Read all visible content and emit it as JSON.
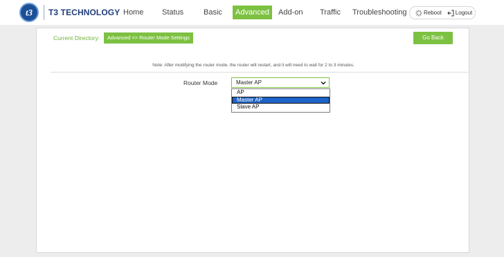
{
  "brand": {
    "name": "T3 TECHNOLOGY",
    "logo_icon": "t3-logo-icon"
  },
  "nav": {
    "items": [
      {
        "label": "Home",
        "active": false
      },
      {
        "label": "Status",
        "active": false
      },
      {
        "label": "Basic",
        "active": false
      },
      {
        "label": "Advanced",
        "active": true
      },
      {
        "label": "Add-on",
        "active": false
      },
      {
        "label": "Traffic",
        "active": false
      },
      {
        "label": "Troubleshooting",
        "active": false
      }
    ]
  },
  "actions": {
    "reboot_label": "Reboot",
    "logout_label": "Logout"
  },
  "breadcrumb": {
    "label": "Current Directory:",
    "value": "Advanced => Router Mode Settings"
  },
  "go_back_label": "Go Back",
  "note": "Note: After modifying the router mode, the router will restart, and it will need to wait for 2 to 3 minutes.",
  "form": {
    "router_mode_label": "Router Mode",
    "router_mode_value": "Master AP",
    "router_mode_options": [
      "AP",
      "Master AP",
      "Slave AP"
    ],
    "highlighted_option": "Master AP"
  },
  "colors": {
    "accent": "#7dc142",
    "brand_blue": "#1f3e7a",
    "selection": "#1e63c7"
  }
}
